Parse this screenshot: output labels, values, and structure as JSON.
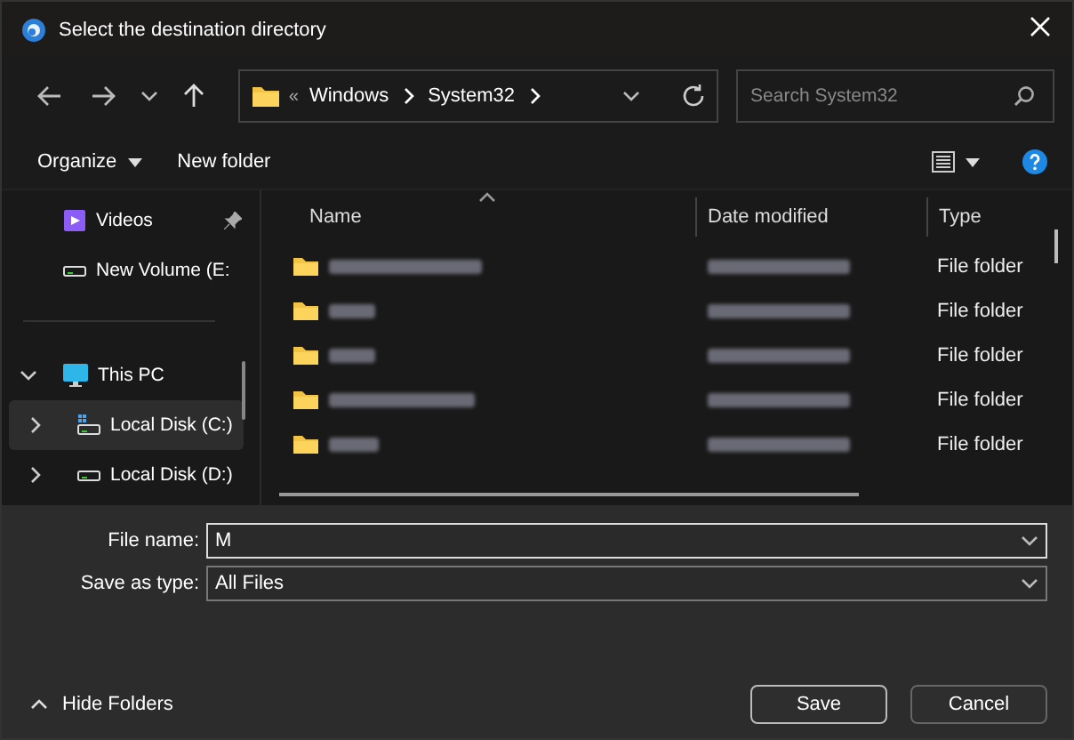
{
  "window": {
    "title": "Select the destination directory"
  },
  "address_bar": {
    "overflow": "«",
    "segments": [
      "Windows",
      "System32"
    ]
  },
  "search": {
    "placeholder": "Search System32"
  },
  "toolbar": {
    "organize": "Organize",
    "new_folder": "New folder"
  },
  "sidebar": {
    "quick_items": [
      {
        "label": "Videos",
        "kind": "videos",
        "pinned": true
      },
      {
        "label": "New Volume (E:",
        "kind": "drive",
        "pinned": false
      }
    ],
    "tree": [
      {
        "label": "This PC",
        "kind": "pc",
        "expanded": true,
        "selected": false,
        "children": [
          {
            "label": "Local Disk (C:)",
            "kind": "system-drive",
            "expanded": false,
            "selected": true
          },
          {
            "label": "Local Disk (D:)",
            "kind": "drive",
            "expanded": false,
            "selected": false
          }
        ]
      }
    ]
  },
  "table": {
    "columns": [
      {
        "label": "Name",
        "sorted": true
      },
      {
        "label": "Date modified",
        "sorted": false
      },
      {
        "label": "Type",
        "sorted": false
      }
    ],
    "rows": [
      {
        "type": "File folder"
      },
      {
        "type": "File folder"
      },
      {
        "type": "File folder"
      },
      {
        "type": "File folder"
      },
      {
        "type": "File folder"
      }
    ]
  },
  "form": {
    "file_name": {
      "label": "File name:",
      "value": "M"
    },
    "save_as_type": {
      "label": "Save as type:",
      "value": "All Files"
    }
  },
  "hide_folders": "Hide Folders",
  "buttons": [
    {
      "label": "Save",
      "default": true
    },
    {
      "label": "Cancel",
      "default": false
    }
  ]
}
